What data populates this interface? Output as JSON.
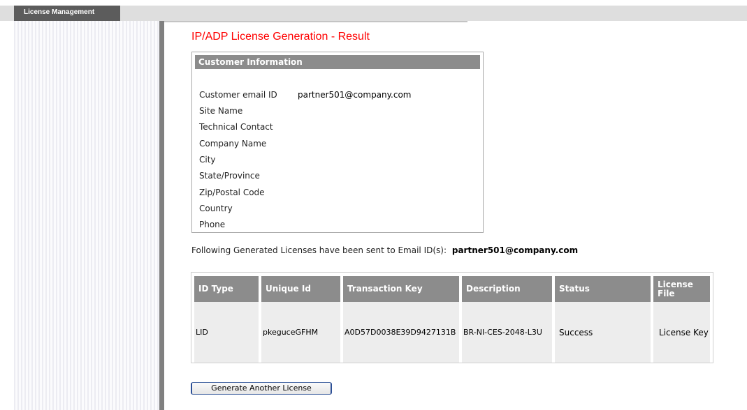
{
  "tab": {
    "label": "License Management"
  },
  "page_title": "IP/ADP License Generation - Result",
  "customer": {
    "header": "Customer Information",
    "rows": [
      {
        "label": "Customer email ID",
        "value": "partner501@company.com"
      },
      {
        "label": "Site Name",
        "value": ""
      },
      {
        "label": "Technical Contact",
        "value": ""
      },
      {
        "label": "Company Name",
        "value": ""
      },
      {
        "label": "City",
        "value": ""
      },
      {
        "label": "State/Province",
        "value": ""
      },
      {
        "label": "Zip/Postal Code",
        "value": ""
      },
      {
        "label": "Country",
        "value": ""
      },
      {
        "label": "Phone",
        "value": ""
      }
    ]
  },
  "sent": {
    "text": "Following Generated Licenses have been sent to Email ID(s):",
    "email": "partner501@company.com"
  },
  "license_table": {
    "headers": [
      "ID Type",
      "Unique Id",
      "Transaction Key",
      "Description",
      "Status",
      "License File"
    ],
    "rows": [
      [
        "LID",
        "pkeguceGFHM",
        "A0D57D0038E39D9427131B",
        "BR-NI-CES-2048-L3U",
        "Success",
        "License Key"
      ]
    ]
  },
  "actions": {
    "generate_another": "Generate Another License"
  }
}
